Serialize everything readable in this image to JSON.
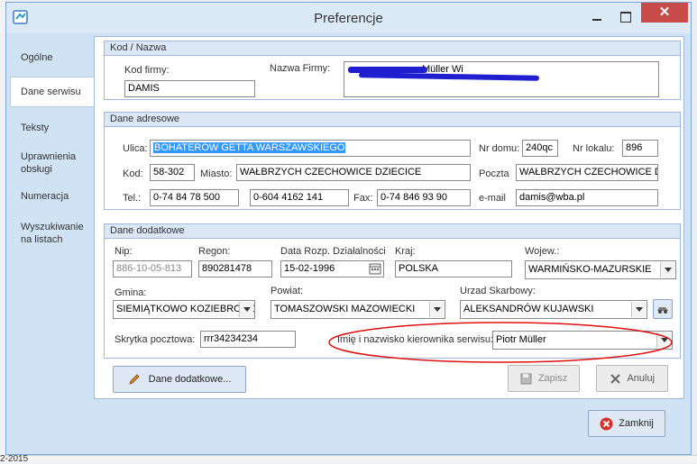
{
  "window": {
    "title": "Preferencje"
  },
  "sidebar": {
    "items": [
      {
        "label": "Ogólne"
      },
      {
        "label": "Dane serwisu"
      },
      {
        "label": "Teksty"
      },
      {
        "label": "Uprawnienia obsługi"
      },
      {
        "label": "Numeracja"
      },
      {
        "label": "Wyszukiwanie na listach"
      }
    ]
  },
  "kod_nazwa": {
    "header": "Kod / Nazwa",
    "kod_label": "Kod firmy:",
    "kod_value": "DAMIS",
    "nazwa_label": "Nazwa Firmy:",
    "nazwa_value_visible": "Müller Wi"
  },
  "adres": {
    "header": "Dane adresowe",
    "ulica_label": "Ulica:",
    "ulica_value": "BOHATERÓW GETTA WARSZAWSKIEGO",
    "nr_domu_label": "Nr domu:",
    "nr_domu_value": "240qc",
    "nr_lokalu_label": "Nr lokalu:",
    "nr_lokalu_value": "896",
    "kod_label": "Kod:",
    "kod_value": "58-302",
    "miasto_label": "Miasto:",
    "miasto_value": "WAŁBRZYCH CZECHOWICE DZIECICE",
    "poczta_label": "Poczta",
    "poczta_value": "WAŁBRZYCH CZECHOWICE DZIE",
    "tel_label": "Tel.:",
    "tel1_value": "0-74 84 78 500",
    "tel2_value": "0-604 4162 141",
    "fax_label": "Fax:",
    "fax_value": "0-74 846 93 90",
    "email_label": "e-mail",
    "email_value": "damis@wba.pl"
  },
  "dodatkowe": {
    "header": "Dane dodatkowe",
    "nip_label": "Nip:",
    "nip_value": "886-10-05-813",
    "regon_label": "Regon:",
    "regon_value": "890281478",
    "data_label": "Data Rozp. Działalności",
    "data_value": "15-02-1996",
    "kraj_label": "Kraj:",
    "kraj_value": "POLSKA",
    "wojew_label": "Wojew.:",
    "wojew_value": "WARMIŃSKO-MAZURSKIE",
    "gmina_label": "Gmina:",
    "gmina_value": "SIEMIĄTKOWO KOZIEBRODZ",
    "powiat_label": "Powiat:",
    "powiat_value": "TOMASZOWSKI MAZOWIECKI",
    "urzad_label": "Urzad Skarbowy:",
    "urzad_value": "ALEKSANDRÓW KUJAWSKI",
    "skrytka_label": "Skrytka pocztowa:",
    "skrytka_value": "rrr34234234",
    "kierownik_label": "Imię i nazwisko kierownika serwisu:",
    "kierownik_value": "Piotr Müller"
  },
  "buttons": {
    "dane_dodatkowe": "Dane dodatkowe...",
    "zapisz": "Zapisz",
    "anuluj": "Anuluj",
    "zamknij": "Zamknij"
  },
  "background": {
    "date_fragment": "2-2015"
  },
  "colors": {
    "highlight_ellipse": "#e01010",
    "redaction": "#1f1fcf",
    "close_button": "#c74b48"
  }
}
